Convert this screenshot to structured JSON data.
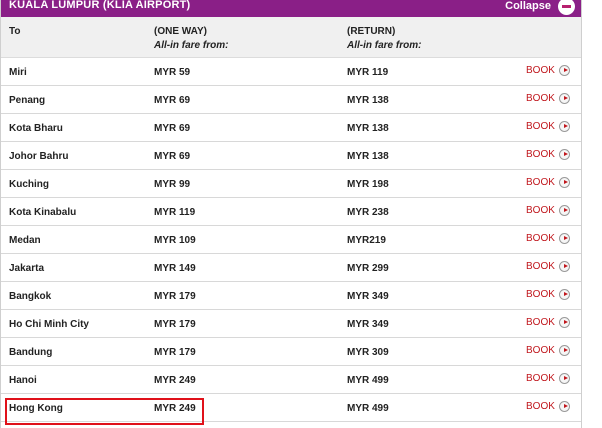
{
  "header": {
    "title": "KUALA LUMPUR (KLIA AIRPORT)",
    "collapse_label": "Collapse"
  },
  "columns": {
    "to": "To",
    "one_way": "(ONE WAY)",
    "one_way_sub": "All-in fare from:",
    "return": "(RETURN)",
    "return_sub": "All-in fare from:"
  },
  "book_label": "BOOK",
  "rows": [
    {
      "to": "Miri",
      "one_way": "MYR 59",
      "return": "MYR 119"
    },
    {
      "to": "Penang",
      "one_way": "MYR 69",
      "return": "MYR 138"
    },
    {
      "to": "Kota Bharu",
      "one_way": "MYR 69",
      "return": "MYR 138"
    },
    {
      "to": "Johor Bahru",
      "one_way": "MYR 69",
      "return": "MYR 138"
    },
    {
      "to": "Kuching",
      "one_way": "MYR 99",
      "return": "MYR 198"
    },
    {
      "to": "Kota Kinabalu",
      "one_way": "MYR 119",
      "return": "MYR 238"
    },
    {
      "to": "Medan",
      "one_way": "MYR 109",
      "return": "MYR219"
    },
    {
      "to": "Jakarta",
      "one_way": "MYR 149",
      "return": "MYR 299"
    },
    {
      "to": "Bangkok",
      "one_way": "MYR 179",
      "return": "MYR 349"
    },
    {
      "to": "Ho Chi Minh City",
      "one_way": "MYR 179",
      "return": "MYR 349"
    },
    {
      "to": "Bandung",
      "one_way": "MYR 179",
      "return": "MYR 309"
    },
    {
      "to": "Hanoi",
      "one_way": "MYR 249",
      "return": "MYR 499"
    },
    {
      "to": "Hong Kong",
      "one_way": "MYR 249",
      "return": "MYR 499"
    }
  ],
  "colors": {
    "header_bg": "#8a1f87",
    "book_red": "#c0161c",
    "highlight_red": "#e0111a"
  }
}
